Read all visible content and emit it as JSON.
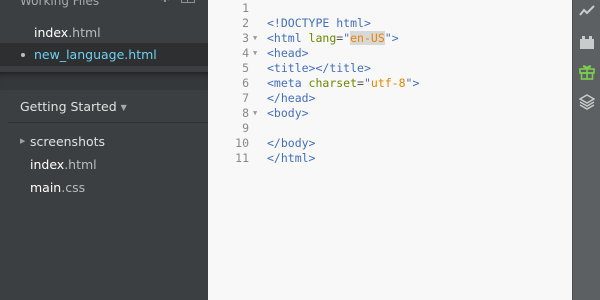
{
  "sidebar": {
    "working_files": {
      "title": "Working Files",
      "files": [
        {
          "base": "index",
          "ext": ".html",
          "active": false
        },
        {
          "base": "new_language",
          "ext": ".html",
          "active": true
        }
      ]
    },
    "project": {
      "title": "Getting Started",
      "items": [
        {
          "base": "screenshots",
          "ext": "",
          "folder": true
        },
        {
          "base": "index",
          "ext": ".html",
          "folder": false
        },
        {
          "base": "main",
          "ext": ".css",
          "folder": false
        }
      ]
    }
  },
  "editor": {
    "lines": [
      {
        "num": "1",
        "fold": "",
        "text": ""
      },
      {
        "num": "2",
        "fold": "",
        "text": "<!DOCTYPE html>"
      },
      {
        "num": "3",
        "fold": "▼",
        "text": "<html lang=\"en-US\">"
      },
      {
        "num": "4",
        "fold": "▼",
        "text": "<head>"
      },
      {
        "num": "5",
        "fold": "",
        "text": "<title></title>"
      },
      {
        "num": "6",
        "fold": "",
        "text": "<meta charset=\"utf-8\">"
      },
      {
        "num": "7",
        "fold": "",
        "text": "</head>"
      },
      {
        "num": "8",
        "fold": "▼",
        "text": "<body>"
      },
      {
        "num": "9",
        "fold": "",
        "text": ""
      },
      {
        "num": "10",
        "fold": "",
        "text": "</body>"
      },
      {
        "num": "11",
        "fold": "",
        "text": "</html>"
      }
    ]
  },
  "toolbar": {
    "icons": [
      "live-preview-icon",
      "extension-manager-icon",
      "gift-icon",
      "layers-icon"
    ],
    "accent": "#7ccf4e"
  },
  "colors": {
    "sidebar_bg": "#3c3f41",
    "active_file": "#6fd0ef",
    "editor_bg": "#f8f8f8",
    "tag": "#446fbd",
    "attr": "#6d8600",
    "string": "#e88501"
  }
}
